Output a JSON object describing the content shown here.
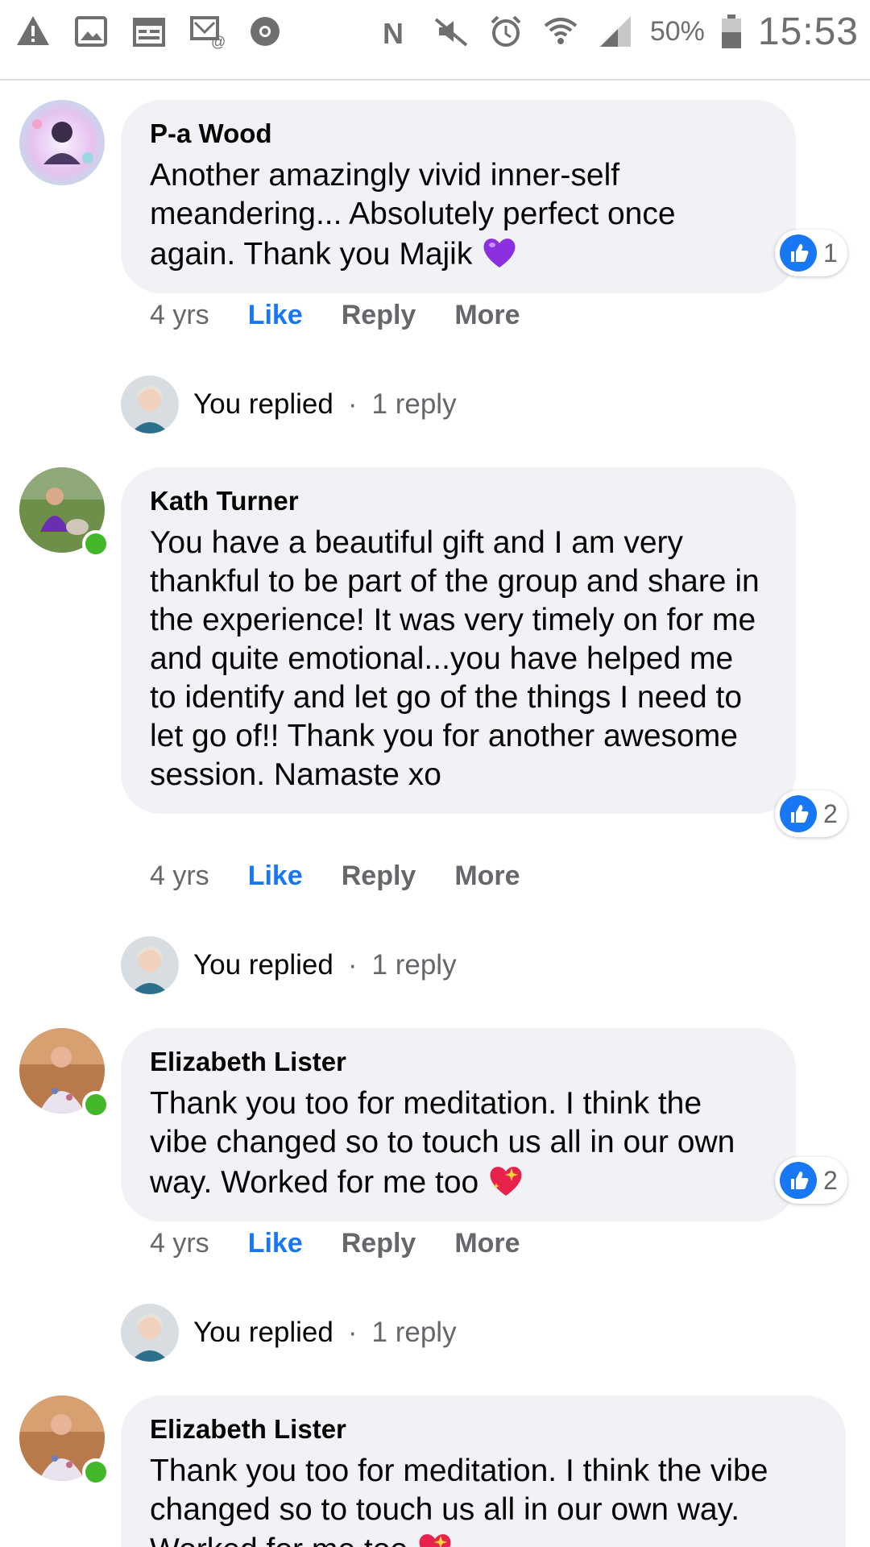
{
  "status_bar": {
    "battery_percent": "50%",
    "time": "15:53",
    "icons_left": [
      "warning-icon",
      "image-icon",
      "calendar-icon",
      "email-icon",
      "chrome-icon"
    ],
    "icons_right": [
      "nfc-icon",
      "mute-icon",
      "alarm-icon",
      "wifi-icon",
      "signal-icon",
      "battery-icon"
    ]
  },
  "actions": {
    "like": "Like",
    "reply": "Reply",
    "more": "More"
  },
  "comments": [
    {
      "author": "P-a Wood",
      "text": "Another amazingly vivid inner-self meandering... Absolutely perfect once again. Thank you Majik",
      "emoji": "purple-heart",
      "time": "4 yrs",
      "reactions": "1",
      "online": false,
      "replied": {
        "you": "You replied",
        "separator": "·",
        "count": "1 reply"
      }
    },
    {
      "author": "Kath Turner",
      "text": "You have a beautiful gift and I am very thankful to be part of the group and share in the experience! It was very timely on for me and quite emotional...you have helped me to identify and let go of the things I need to let go of!! Thank you for another awesome session. Namaste xo",
      "time": "4 yrs",
      "reactions": "2",
      "online": true,
      "replied": {
        "you": "You replied",
        "separator": "·",
        "count": "1 reply"
      }
    },
    {
      "author": "Elizabeth Lister",
      "text": "Thank you too for meditation. I think the vibe changed so to touch us all in our own way. Worked for me too",
      "emoji": "sparkling-heart",
      "time": "4 yrs",
      "reactions": "2",
      "online": true,
      "replied": {
        "you": "You replied",
        "separator": "·",
        "count": "1 reply"
      }
    },
    {
      "author": "Elizabeth Lister",
      "text": "Thank you too for meditation. I think the vibe changed so to touch us all in our own way. Worked for me too",
      "emoji": "sparkling-heart",
      "online": true
    }
  ]
}
